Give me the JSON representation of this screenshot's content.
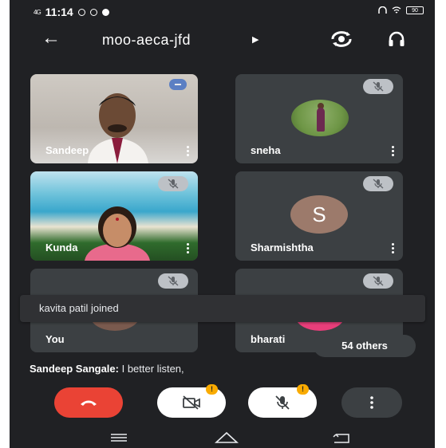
{
  "status_bar": {
    "signal": "4G",
    "time": "11:14",
    "battery": "90"
  },
  "header": {
    "meeting_code": "moo-aeca-jfd"
  },
  "participants": [
    {
      "name": "Sandeep"
    },
    {
      "name": "sneha"
    },
    {
      "name": "Kunda"
    },
    {
      "name": "Sharmishtha",
      "initial": "S"
    },
    {
      "name": "You"
    },
    {
      "name": "bharati"
    }
  ],
  "toast": {
    "text": "kavita patil joined"
  },
  "others_chip": {
    "label": "54 others"
  },
  "caption": {
    "speaker": "Sandeep Sangale:",
    "text": " I better listen,"
  },
  "controls": {
    "camera_badge": "!",
    "mic_badge": "!"
  },
  "colors": {
    "end_call": "#ea4335",
    "background": "#202124",
    "tile": "#3c4043",
    "warning": "#f9ab00"
  }
}
